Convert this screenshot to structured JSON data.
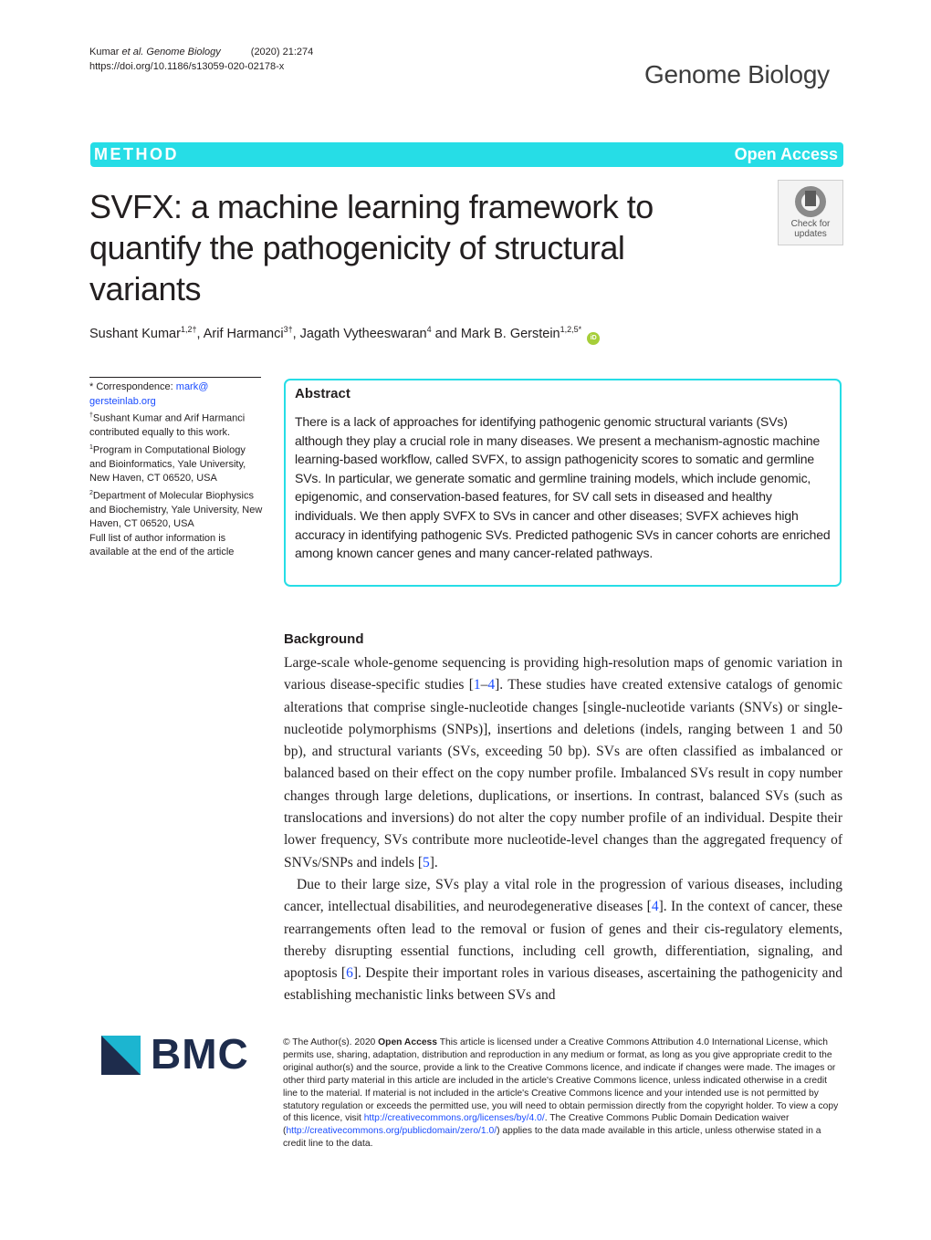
{
  "header": {
    "citation_authors": "Kumar",
    "citation_etal": "et al.",
    "citation_journal": "Genome Biology",
    "citation_year_volume": "(2020) 21:274",
    "doi": "https://doi.org/10.1186/s13059-020-02178-x",
    "journal_logo": "Genome Biology"
  },
  "banner": {
    "article_type": "METHOD",
    "access": "Open Access",
    "color": "#26dde6"
  },
  "title": "SVFX: a machine learning framework to quantify the pathogenicity of structural variants",
  "crossmark": {
    "icon": "crossmark-icon",
    "line1": "Check for",
    "line2": "updates"
  },
  "authors": [
    {
      "name": "Sushant Kumar",
      "sup": "1,2†"
    },
    {
      "name": "Arif Harmanci",
      "sup": "3†"
    },
    {
      "name": "Jagath Vytheeswaran",
      "sup": "4"
    },
    {
      "name": "Mark B. Gerstein",
      "sup": "1,2,5*"
    }
  ],
  "authors_sep": ", ",
  "authors_and": " and ",
  "orcid_label": "iD",
  "affiliations": {
    "correspondence_label": "* Correspondence: ",
    "correspondence_email_1": "mark@",
    "correspondence_email_2": "gersteinlab.org",
    "equal_sup": "†",
    "equal_text": "Sushant Kumar and Arif Harmanci contributed equally to this work.",
    "aff1_sup": "1",
    "aff1_text": "Program in Computational Biology and Bioinformatics, Yale University, New Haven, CT 06520, USA",
    "aff2_sup": "2",
    "aff2_text": "Department of Molecular Biophysics and Biochemistry, Yale University, New Haven, CT 06520, USA",
    "full_list": "Full list of author information is available at the end of the article"
  },
  "abstract": {
    "heading": "Abstract",
    "text": "There is a lack of approaches for identifying pathogenic genomic structural variants (SVs) although they play a crucial role in many diseases. We present a mechanism-agnostic machine learning-based workflow, called SVFX, to assign pathogenicity scores to somatic and germline SVs. In particular, we generate somatic and germline training models, which include genomic, epigenomic, and conservation-based features, for SV call sets in diseased and healthy individuals. We then apply SVFX to SVs in cancer and other diseases; SVFX achieves high accuracy in identifying pathogenic SVs. Predicted pathogenic SVs in cancer cohorts are enriched among known cancer genes and many cancer-related pathways."
  },
  "background": {
    "heading": "Background",
    "p1_a": "Large-scale whole-genome sequencing is providing high-resolution maps of genomic variation in various disease-specific studies [",
    "p1_ref1": "1",
    "p1_dash": "–",
    "p1_ref2": "4",
    "p1_b": "]. These studies have created extensive catalogs of genomic alterations that comprise single-nucleotide changes [single-nucleotide variants (SNVs) or single-nucleotide polymorphisms (SNPs)], insertions and deletions (indels, ranging between 1 and 50 bp), and structural variants (SVs, exceeding 50 bp). SVs are often classified as imbalanced or balanced based on their effect on the copy number profile. Imbalanced SVs result in copy number changes through large deletions, duplications, or insertions. In contrast, balanced SVs (such as translocations and inversions) do not alter the copy number profile of an individual. Despite their lower frequency, SVs contribute more nucleotide-level changes than the aggregated frequency of SNVs/SNPs and indels [",
    "p1_ref3": "5",
    "p1_c": "].",
    "p2_a": "Due to their large size, SVs play a vital role in the progression of various diseases, including cancer, intellectual disabilities, and neurodegenerative diseases [",
    "p2_ref1": "4",
    "p2_b": "]. In the context of cancer, these rearrangements often lead to the removal or fusion of genes and their cis-regulatory elements, thereby disrupting essential functions, including cell growth, differentiation, signaling, and apoptosis [",
    "p2_ref2": "6",
    "p2_c": "]. Despite their important roles in various diseases, ascertaining the pathogenicity and establishing mechanistic links between SVs and"
  },
  "publisher_logo": "BMC",
  "license": {
    "a": "© The Author(s). 2020 ",
    "bold": "Open Access",
    "b": " This article is licensed under a Creative Commons Attribution 4.0 International License, which permits use, sharing, adaptation, distribution and reproduction in any medium or format, as long as you give appropriate credit to the original author(s) and the source, provide a link to the Creative Commons licence, and indicate if changes were made. The images or other third party material in this article are included in the article's Creative Commons licence, unless indicated otherwise in a credit line to the material. If material is not included in the article's Creative Commons licence and your intended use is not permitted by statutory regulation or exceeds the permitted use, you will need to obtain permission directly from the copyright holder. To view a copy of this licence, visit ",
    "link1": "http://creativecommons.org/licenses/by/4.0/",
    "c": ". The Creative Commons Public Domain Dedication waiver (",
    "link2": "http://creativecommons.org/publicdomain/zero/1.0/",
    "d": ") applies to the data made available in this article, unless otherwise stated in a credit line to the data."
  }
}
